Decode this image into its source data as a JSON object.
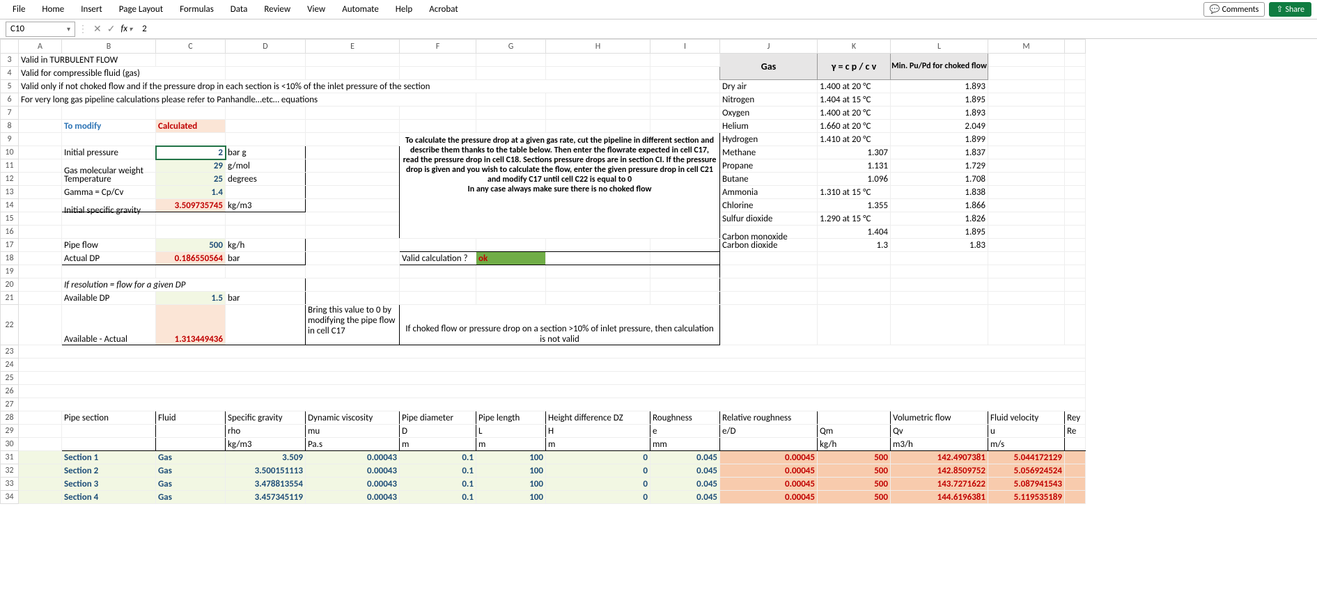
{
  "ribbon": {
    "tabs": [
      "File",
      "Home",
      "Insert",
      "Page Layout",
      "Formulas",
      "Data",
      "Review",
      "View",
      "Automate",
      "Help",
      "Acrobat"
    ],
    "comments": "Comments",
    "share": "Share"
  },
  "formulaBar": {
    "nameBox": "C10",
    "formula": "2"
  },
  "colHeaders": [
    "A",
    "B",
    "C",
    "D",
    "E",
    "F",
    "G",
    "H",
    "I",
    "J",
    "K",
    "L",
    "M",
    ""
  ],
  "rowHeaders": [
    3,
    4,
    5,
    6,
    7,
    8,
    9,
    10,
    11,
    12,
    13,
    14,
    15,
    16,
    17,
    18,
    19,
    20,
    21,
    22,
    23,
    24,
    25,
    26,
    27,
    28,
    29,
    30,
    31,
    32,
    33,
    34
  ],
  "notes": {
    "r3": "Valid in TURBULENT FLOW",
    "r4": "Valid for compressible fluid (gas)",
    "r5": "Valid only if not choked flow and if the pressure drop in each section is <10% of the inlet pressure of the section",
    "r6": "For very long gas pipeline calculations please refer to Panhandle…etc… equations"
  },
  "legend": {
    "modify": "To modify",
    "calculated": "Calculated"
  },
  "inputs": {
    "p_label": "Initial pressure",
    "p_val": "2",
    "p_unit": "bar g",
    "mw_label": "Gas molecular weight",
    "mw_val": "29",
    "mw_unit": "g/mol",
    "t_label": "Temperature",
    "t_val": "25",
    "t_unit": "degrees",
    "g_label": "Gamma = Cp/Cv",
    "g_val": "1.4",
    "sg_label": "Initial specific gravity",
    "sg_val": "3.509735745",
    "sg_unit": "kg/m3",
    "flow_label": "Pipe flow",
    "flow_val": "500",
    "flow_unit": "kg/h",
    "dp_label": "Actual DP",
    "dp_val": "0.186550564",
    "dp_unit": "bar",
    "res_label": "If resolution = flow for a given DP",
    "avdp_label": "Available DP",
    "avdp_val": "1.5",
    "avdp_unit": "bar",
    "diff_label": "Available - Actual",
    "diff_val": "1.313449436",
    "bring0": "Bring this value to 0 by modifying the pipe flow in cell C17"
  },
  "instructions": {
    "main": "To calculate the pressure drop at a given gas rate, cut the pipeline in different section and describe them thanks to the table below. Then enter the flowrate expected in cell C17, read the pressure drop in cell C18. Sections pressure drops are in section CI. If the pressure drop is given and you wish to calculate the flow, enter the given pressure drop in cell C21 and modify C17 until cell C22 is equal to 0",
    "any": "In any case always make sure there is no choked flow",
    "valid_label": "Valid calculation ?",
    "valid_val": "ok",
    "choked": "If choked flow or pressure drop on a section >10% of inlet pressure, then calculation is not valid"
  },
  "gasTable": {
    "hdr_gas": "Gas",
    "hdr_gamma": "γ = c p / c v",
    "hdr_ratio": "Min. Pu/Pd for choked flow",
    "rows": [
      {
        "name": "Dry air",
        "gamma": "1.400 at 20 °C",
        "ratio": "1.893"
      },
      {
        "name": "Nitrogen",
        "gamma": "1.404 at 15 °C",
        "ratio": "1.895"
      },
      {
        "name": "Oxygen",
        "gamma": "1.400 at 20 °C",
        "ratio": "1.893"
      },
      {
        "name": "Helium",
        "gamma": "1.660 at 20 °C",
        "ratio": "2.049"
      },
      {
        "name": "Hydrogen",
        "gamma": "1.410 at 20 °C",
        "ratio": "1.899"
      },
      {
        "name": "Methane",
        "gamma": "1.307",
        "ratio": "1.837"
      },
      {
        "name": "Propane",
        "gamma": "1.131",
        "ratio": "1.729"
      },
      {
        "name": "Butane",
        "gamma": "1.096",
        "ratio": "1.708"
      },
      {
        "name": "Ammonia",
        "gamma": "1.310 at 15 °C",
        "ratio": "1.838"
      },
      {
        "name": "Chlorine",
        "gamma": "1.355",
        "ratio": "1.866"
      },
      {
        "name": "Sulfur dioxide",
        "gamma": "1.290 at 15 °C",
        "ratio": "1.826"
      },
      {
        "name": "Carbon monoxide",
        "gamma": "1.404",
        "ratio": "1.895"
      },
      {
        "name": "Carbon dioxide",
        "gamma": "1.3",
        "ratio": "1.83"
      }
    ]
  },
  "sectionTable": {
    "headers28": [
      "Pipe section",
      "Fluid",
      "Specific gravity",
      "Dynamic viscosity",
      "Pipe diameter",
      "Pipe length",
      "Height difference DZ",
      "Roughness",
      "Relative roughness",
      "",
      "Volumetric flow",
      "Fluid velocity",
      "Rey"
    ],
    "headers29": [
      "",
      "",
      "rho",
      "mu",
      "D",
      "L",
      "H",
      "e",
      "e/D",
      "Qm",
      "Qv",
      "u",
      "Re"
    ],
    "headers30": [
      "",
      "",
      "kg/m3",
      "Pa.s",
      "m",
      "m",
      "m",
      "mm",
      "",
      "kg/h",
      "m3/h",
      "m/s",
      ""
    ],
    "rows": [
      {
        "sec": "Section 1",
        "fluid": "Gas",
        "sg": "3.509",
        "mu": "0.00043",
        "d": "0.1",
        "l": "100",
        "h": "0",
        "e": "0.045",
        "ed": "0.00045",
        "qm": "500",
        "qv": "142.4907381",
        "u": "5.044172129"
      },
      {
        "sec": "Section 2",
        "fluid": "Gas",
        "sg": "3.500151113",
        "mu": "0.00043",
        "d": "0.1",
        "l": "100",
        "h": "0",
        "e": "0.045",
        "ed": "0.00045",
        "qm": "500",
        "qv": "142.8509752",
        "u": "5.056924524"
      },
      {
        "sec": "Section 3",
        "fluid": "Gas",
        "sg": "3.478813554",
        "mu": "0.00043",
        "d": "0.1",
        "l": "100",
        "h": "0",
        "e": "0.045",
        "ed": "0.00045",
        "qm": "500",
        "qv": "143.7271622",
        "u": "5.087941543"
      },
      {
        "sec": "Section 4",
        "fluid": "Gas",
        "sg": "3.457345119",
        "mu": "0.00043",
        "d": "0.1",
        "l": "100",
        "h": "0",
        "e": "0.045",
        "ed": "0.00045",
        "qm": "500",
        "qv": "144.6196381",
        "u": "5.119535189"
      }
    ]
  }
}
